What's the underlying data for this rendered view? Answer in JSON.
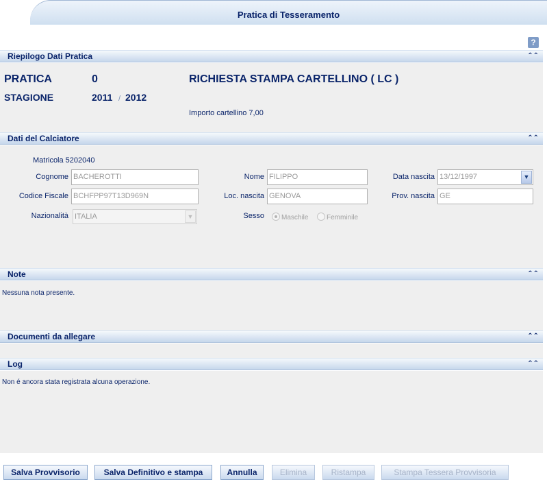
{
  "page": {
    "title": "Pratica di Tesseramento"
  },
  "sections": {
    "riepilogo": "Riepilogo Dati Pratica",
    "calciatore": "Dati del Calciatore",
    "note": "Note",
    "documenti": "Documenti da allegare",
    "log": "Log"
  },
  "riepilogo": {
    "pratica_label": "PRATICA",
    "pratica_value": "0",
    "richiesta": "RICHIESTA STAMPA CARTELLINO  ( LC )",
    "stagione_label": "STAGIONE",
    "stagione_start": "2011",
    "stagione_sep": "/",
    "stagione_end": "2012",
    "importo": "Importo cartellino 7,00"
  },
  "calciatore": {
    "matricola": "Matricola 5202040",
    "cognome_label": "Cognome",
    "cognome": "BACHEROTTI",
    "nome_label": "Nome",
    "nome": "FILIPPO",
    "data_nascita_label": "Data nascita",
    "data_nascita": "13/12/1997",
    "codice_fiscale_label": "Codice Fiscale",
    "codice_fiscale": "BCHFPP97T13D969N",
    "loc_nascita_label": "Loc. nascita",
    "loc_nascita": "GENOVA",
    "prov_nascita_label": "Prov. nascita",
    "prov_nascita": "GE",
    "nazionalita_label": "Nazionalità",
    "nazionalita": "ITALIA",
    "sesso_label": "Sesso",
    "sesso_maschile": "Maschile",
    "sesso_femminile": "Femminile",
    "sesso_selected": "Maschile"
  },
  "note": {
    "text": "Nessuna nota presente."
  },
  "log": {
    "text": "Non é ancora stata registrata alcuna operazione."
  },
  "buttons": {
    "salva_provvisorio": "Salva Provvisorio",
    "salva_definitivo": "Salva Definitivo e stampa",
    "annulla": "Annulla",
    "elimina": "Elimina",
    "ristampa": "Ristampa",
    "stampa_tessera": "Stampa Tessera Provvisoria"
  },
  "icons": {
    "help": "help-icon",
    "collapse": "double-chevron-up-icon",
    "dropdown": "chevron-down-icon"
  }
}
